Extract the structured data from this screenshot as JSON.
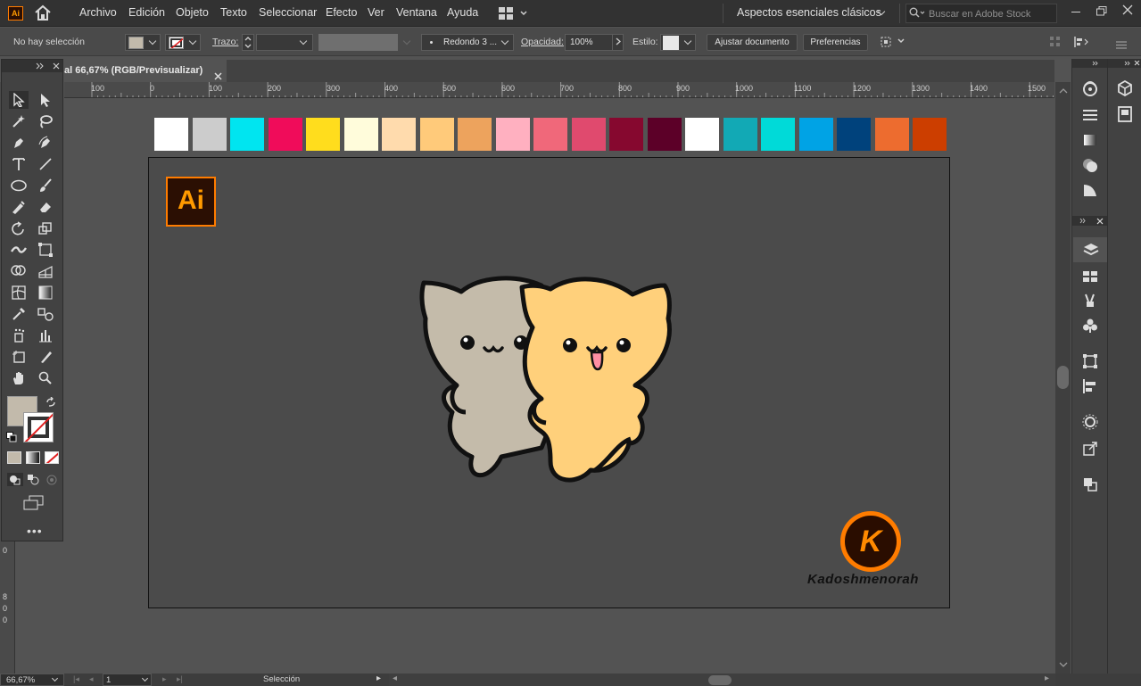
{
  "app": {
    "logo_text": "Ai"
  },
  "menu": [
    "Archivo",
    "Edición",
    "Objeto",
    "Texto",
    "Seleccionar",
    "Efecto",
    "Ver",
    "Ventana",
    "Ayuda"
  ],
  "workspace": {
    "label": "Aspectos esenciales clásicos"
  },
  "stock_search": {
    "placeholder": "Buscar en Adobe Stock"
  },
  "control": {
    "selection": "No hay selección",
    "stroke_label": "Trazo:",
    "brush": "Redondo 3 ...",
    "opacity_label": "Opacidad:",
    "opacity_value": "100%",
    "style_label": "Estilo:",
    "fit_button": "Ajustar documento",
    "prefs_button": "Preferencias"
  },
  "doc_tab": {
    "title": "al 66,67% (RGB/Previsualizar)"
  },
  "ruler": {
    "labels": [
      "100",
      "0",
      "100",
      "200",
      "300",
      "400",
      "500",
      "600",
      "700",
      "800",
      "900",
      "1000",
      "1100",
      "1200",
      "1300",
      "1400",
      "1500"
    ]
  },
  "ruler_v": {
    "labels": [
      "0",
      "8",
      "0",
      "0"
    ]
  },
  "swatches": [
    "#ffffff",
    "#cccccc",
    "#00e5f0",
    "#f00c5a",
    "#ffdd1d",
    "#fffcdb",
    "#ffdbad",
    "#ffca7a",
    "#eda35d",
    "#ffb0c0",
    "#f0687a",
    "#e04a6e",
    "#86082f",
    "#5c0028",
    "#ffffff",
    "#12a9b5",
    "#00dad8",
    "#00a3e5",
    "#00427c",
    "#ed6c2f",
    "#cc3e00"
  ],
  "artboard": {
    "ai_badge": "Ai",
    "brand_initial": "K",
    "brand_name": "Kadoshmenorah"
  },
  "colors": {
    "fill": "#c2baab",
    "accent": "#ff7c00",
    "cat_grey": "#c4bbaa",
    "cat_orange": "#ffd07b"
  },
  "status": {
    "zoom": "66,67%",
    "artboard_num": "1",
    "tool": "Selección"
  }
}
